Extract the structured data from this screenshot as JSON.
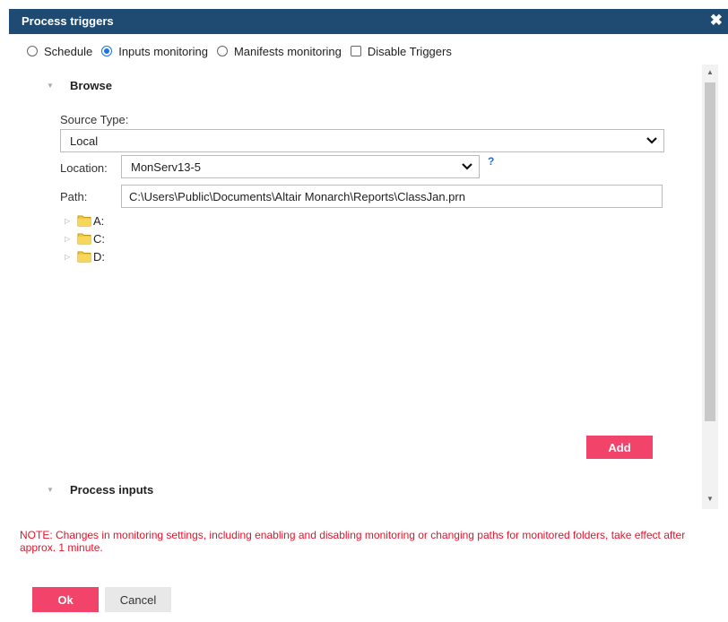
{
  "dialog": {
    "title": "Process triggers",
    "close_glyph": "✖"
  },
  "triggers": {
    "schedule_label": "Schedule",
    "inputs_monitoring_label": "Inputs monitoring",
    "manifests_monitoring_label": "Manifests monitoring",
    "disable_triggers_label": "Disable Triggers",
    "selected": "Inputs monitoring"
  },
  "browse": {
    "header": "Browse",
    "source_type_label": "Source Type:",
    "source_type_value": "Local",
    "location_label": "Location:",
    "location_value": "MonServ13-5",
    "help_glyph": "?",
    "path_label": "Path:",
    "path_value": "C:\\Users\\Public\\Documents\\Altair Monarch\\Reports\\ClassJan.prn",
    "tree": [
      {
        "label": "A:"
      },
      {
        "label": "C:"
      },
      {
        "label": "D:"
      }
    ],
    "add_label": "Add"
  },
  "process_inputs": {
    "header": "Process inputs"
  },
  "note": "NOTE: Changes in monitoring settings, including enabling and disabling monitoring or changing paths for monitored folders, take effect after approx. 1 minute.",
  "footer": {
    "ok_label": "Ok",
    "cancel_label": "Cancel"
  },
  "colors": {
    "titlebar": "#1f4b73",
    "accent": "#f2436a",
    "note": "#e8122a",
    "radio_selected": "#1a73e8"
  },
  "icons": {
    "close": "close-icon",
    "collapse": "caret-down-icon",
    "expand": "caret-right-icon",
    "folder": "folder-icon",
    "dropdown": "chevron-down-icon",
    "help": "help-icon"
  }
}
